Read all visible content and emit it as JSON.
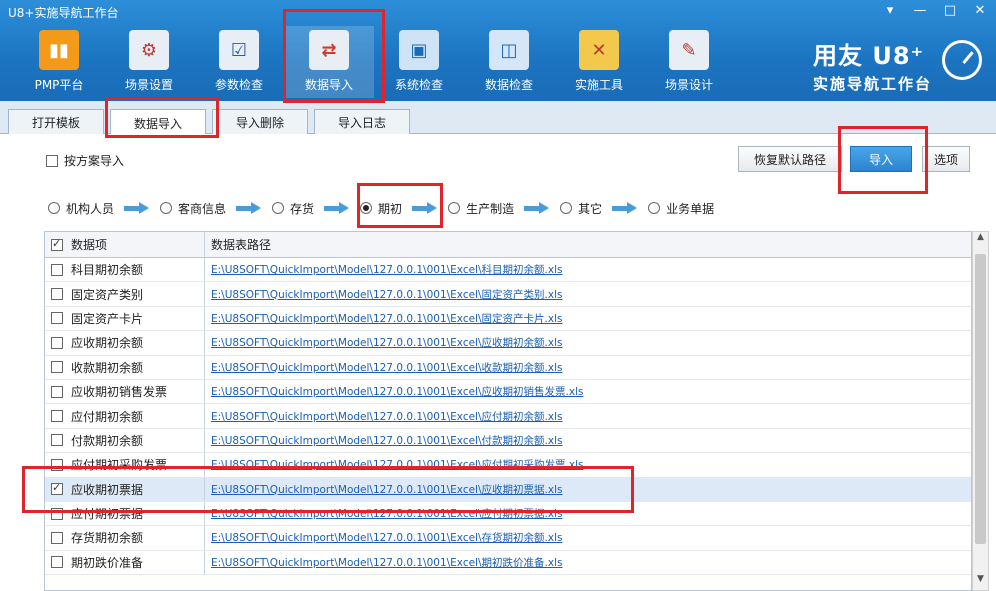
{
  "window": {
    "title": "U8+实施导航工作台",
    "controls": [
      "▾",
      "—",
      "□",
      "✕"
    ]
  },
  "toolbar": [
    {
      "label": "PMP平台",
      "icon": "pmp-chart-icon",
      "color": "#f39a1b"
    },
    {
      "label": "场景设置",
      "icon": "scene-settings-icon",
      "color": "#e8eef6"
    },
    {
      "label": "参数检查",
      "icon": "param-check-icon",
      "color": "#e8eef6"
    },
    {
      "label": "数据导入",
      "icon": "data-import-icon",
      "color": "#e9eef5"
    },
    {
      "label": "系统检查",
      "icon": "system-check-icon",
      "color": "#cfe3f7"
    },
    {
      "label": "数据检查",
      "icon": "data-check-icon",
      "color": "#d4e6f7"
    },
    {
      "label": "实施工具",
      "icon": "tools-icon",
      "color": "#f2c94c"
    },
    {
      "label": "场景设计",
      "icon": "scene-design-icon",
      "color": "#e8eef6"
    }
  ],
  "brand": {
    "line1": "用友 U8⁺",
    "line2": "实施导航工作台"
  },
  "tabs": [
    "打开模板",
    "数据导入",
    "导入删除",
    "导入日志"
  ],
  "options": {
    "plan_import_label": "按方案导入",
    "restore_default_label": "恢复默认路径",
    "import_label": "导入",
    "options_label": "选项"
  },
  "steps": [
    "机构人员",
    "客商信息",
    "存货",
    "期初",
    "生产制造",
    "其它",
    "业务单据"
  ],
  "grid": {
    "headers": [
      "数据项",
      "数据表路径"
    ],
    "rows": [
      {
        "name": "科目期初余额",
        "path": "E:\\U8SOFT\\QuickImport\\Model\\127.0.0.1\\001\\Excel\\科目期初余额.xls",
        "checked": false
      },
      {
        "name": "固定资产类别",
        "path": "E:\\U8SOFT\\QuickImport\\Model\\127.0.0.1\\001\\Excel\\固定资产类别.xls",
        "checked": false
      },
      {
        "name": "固定资产卡片",
        "path": "E:\\U8SOFT\\QuickImport\\Model\\127.0.0.1\\001\\Excel\\固定资产卡片.xls",
        "checked": false
      },
      {
        "name": "应收期初余额",
        "path": "E:\\U8SOFT\\QuickImport\\Model\\127.0.0.1\\001\\Excel\\应收期初余额.xls",
        "checked": false
      },
      {
        "name": "收款期初余额",
        "path": "E:\\U8SOFT\\QuickImport\\Model\\127.0.0.1\\001\\Excel\\收款期初余额.xls",
        "checked": false
      },
      {
        "name": "应收期初销售发票",
        "path": "E:\\U8SOFT\\QuickImport\\Model\\127.0.0.1\\001\\Excel\\应收期初销售发票.xls",
        "checked": false
      },
      {
        "name": "应付期初余额",
        "path": "E:\\U8SOFT\\QuickImport\\Model\\127.0.0.1\\001\\Excel\\应付期初余额.xls",
        "checked": false
      },
      {
        "name": "付款期初余额",
        "path": "E:\\U8SOFT\\QuickImport\\Model\\127.0.0.1\\001\\Excel\\付款期初余额.xls",
        "checked": false
      },
      {
        "name": "应付期初采购发票",
        "path": "E:\\U8SOFT\\QuickImport\\Model\\127.0.0.1\\001\\Excel\\应付期初采购发票.xls",
        "checked": false
      },
      {
        "name": "应收期初票据",
        "path": "E:\\U8SOFT\\QuickImport\\Model\\127.0.0.1\\001\\Excel\\应收期初票据.xls",
        "checked": true
      },
      {
        "name": "应付期初票据",
        "path": "E:\\U8SOFT\\QuickImport\\Model\\127.0.0.1\\001\\Excel\\应付期初票据.xls",
        "checked": false
      },
      {
        "name": "存货期初余额",
        "path": "E:\\U8SOFT\\QuickImport\\Model\\127.0.0.1\\001\\Excel\\存货期初余额.xls",
        "checked": false
      },
      {
        "name": "期初跌价准备",
        "path": "E:\\U8SOFT\\QuickImport\\Model\\127.0.0.1\\001\\Excel\\期初跌价准备.xls",
        "checked": false
      }
    ]
  },
  "colors": {
    "titlebar": "#1c74c1",
    "highlight": "#e0242b",
    "link": "#1a5fb4",
    "arrow": "#4a9bd8"
  }
}
